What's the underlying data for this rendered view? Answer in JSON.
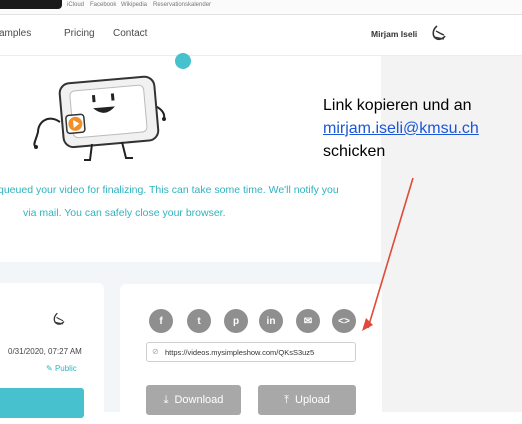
{
  "browser": {
    "bookmarks": [
      "iCloud",
      "Facebook",
      "Wikipedia",
      "Reservationskalender"
    ]
  },
  "nav": {
    "examples_label": "amples",
    "pricing_label": "Pricing",
    "contact_label": "Contact",
    "user_name": "Mirjam Iseli"
  },
  "status": {
    "line1": "queued your video for finalizing. This can take some time. We'll notify you",
    "line2": "via mail. You can safely close your browser."
  },
  "annotation": {
    "line1": "Link kopieren und an",
    "email": "mirjam.iseli@kmsu.ch",
    "line3": "schicken"
  },
  "video_card": {
    "date": "0/31/2020, 07:27 AM",
    "visibility": "Public"
  },
  "share": {
    "icons": [
      "facebook-icon",
      "twitter-icon",
      "pinterest-icon",
      "linkedin-icon",
      "mail-icon",
      "embed-icon"
    ],
    "glyphs": [
      "f",
      "t",
      "p",
      "in",
      "✉",
      "<>"
    ],
    "url_value": "https://videos.mysimpleshow.com/QKsS3uz5",
    "download_label": "Download",
    "upload_label": "Upload"
  },
  "colors": {
    "accent": "#2fb3bf",
    "share_button": "#8f8f8f",
    "action_button": "#a8a8a8",
    "annotation_arrow": "#e04a3a",
    "link": "#1a56d8"
  }
}
